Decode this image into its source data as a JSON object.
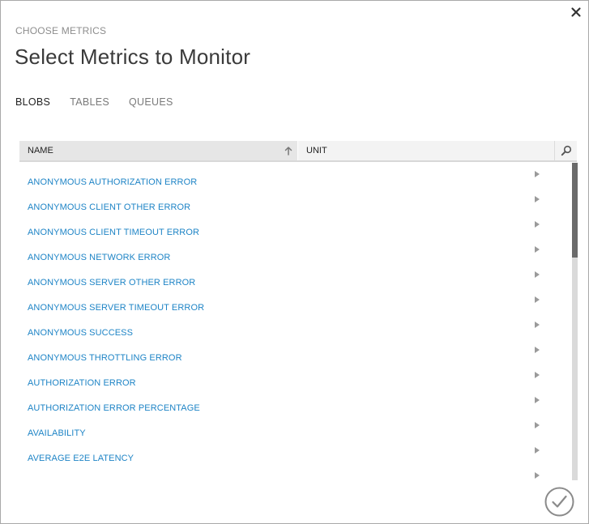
{
  "dialog": {
    "eyebrow": "CHOOSE METRICS",
    "title": "Select Metrics to Monitor"
  },
  "tabs": [
    {
      "label": "BLOBS",
      "active": true
    },
    {
      "label": "TABLES",
      "active": false
    },
    {
      "label": "QUEUES",
      "active": false
    }
  ],
  "grid": {
    "columns": {
      "name": "NAME",
      "unit": "UNIT"
    },
    "sort": "ascending",
    "rows": [
      {
        "name": "ANONYMOUS AUTHORIZATION ERROR"
      },
      {
        "name": "ANONYMOUS CLIENT OTHER ERROR"
      },
      {
        "name": "ANONYMOUS CLIENT TIMEOUT ERROR"
      },
      {
        "name": "ANONYMOUS NETWORK ERROR"
      },
      {
        "name": "ANONYMOUS SERVER OTHER ERROR"
      },
      {
        "name": "ANONYMOUS SERVER TIMEOUT ERROR"
      },
      {
        "name": "ANONYMOUS SUCCESS"
      },
      {
        "name": "ANONYMOUS THROTTLING ERROR"
      },
      {
        "name": "AUTHORIZATION ERROR"
      },
      {
        "name": "AUTHORIZATION ERROR PERCENTAGE"
      },
      {
        "name": "AVAILABILITY"
      },
      {
        "name": "AVERAGE E2E LATENCY"
      },
      {
        "name": ""
      }
    ]
  },
  "icons": {
    "close": "close-icon",
    "sort": "sort-ascending-icon",
    "search": "search-icon",
    "expand": "chevron-right-icon",
    "confirm": "checkmark-icon"
  },
  "colors": {
    "link": "#1e84c6",
    "header_bg": "#e6e6e6",
    "scroll_thumb": "#6b6b6b",
    "confirm": "#8a8a8a"
  }
}
